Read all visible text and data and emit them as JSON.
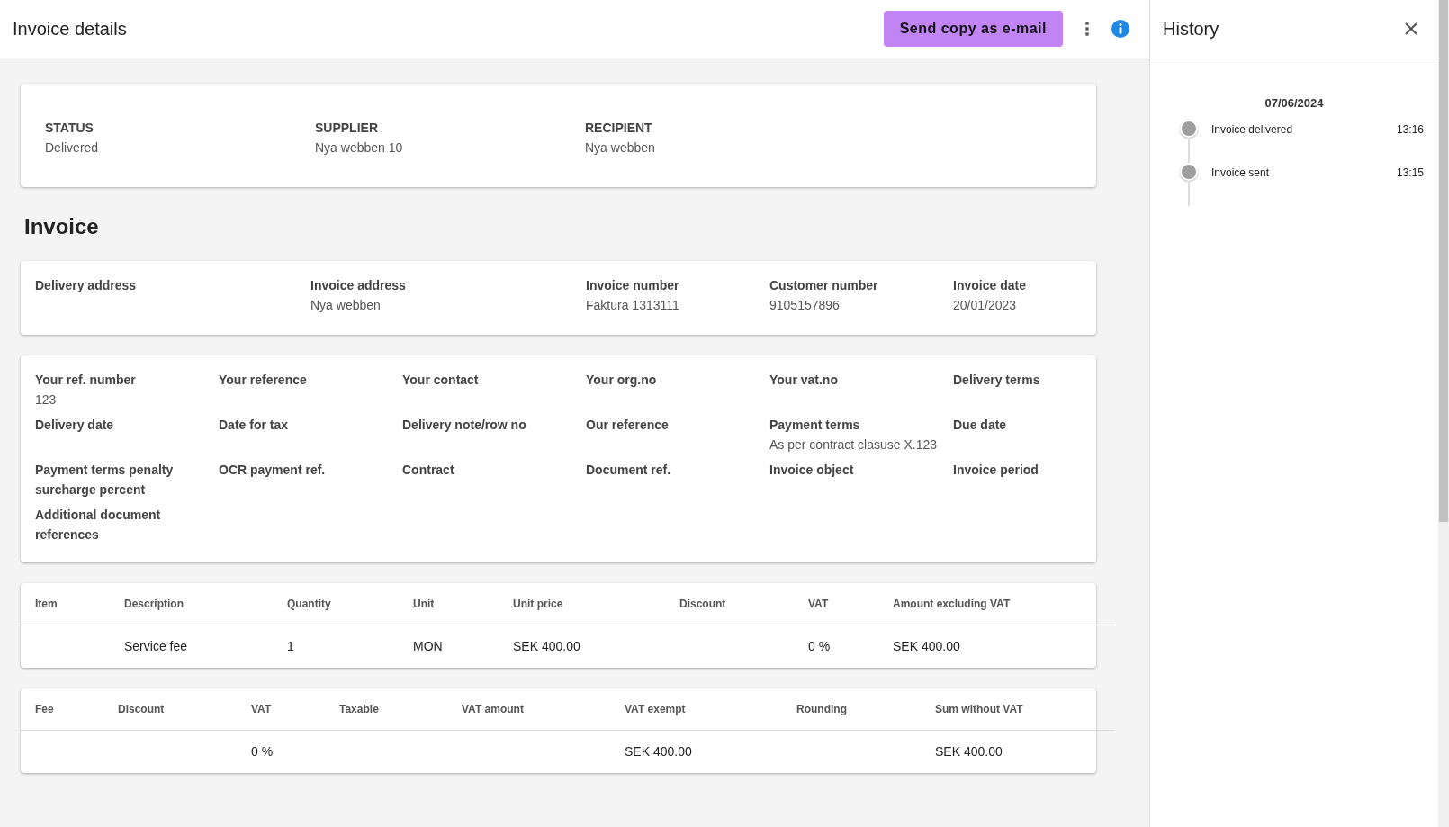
{
  "header": {
    "title": "Invoice details",
    "send_button": "Send copy as e-mail"
  },
  "status_card": [
    {
      "label": "STATUS",
      "value": "Delivered"
    },
    {
      "label": "SUPPLIER",
      "value": "Nya webben 10"
    },
    {
      "label": "RECIPIENT",
      "value": "Nya webben"
    }
  ],
  "invoice_heading": "Invoice",
  "address_card": [
    {
      "label": "Delivery address"
    },
    {
      "label": "Invoice address",
      "value": "Nya webben"
    },
    {
      "label": "Invoice number",
      "value": "Faktura 1313111"
    },
    {
      "label": "Customer number",
      "value": "9105157896"
    },
    {
      "label": "Invoice date",
      "value": "20/01/2023"
    }
  ],
  "details_card": [
    {
      "label": "Your ref. number",
      "value": "123"
    },
    {
      "label": "Your reference"
    },
    {
      "label": "Your contact"
    },
    {
      "label": "Your org.no"
    },
    {
      "label": "Your vat.no"
    },
    {
      "label": "Delivery terms"
    },
    {
      "label": "Delivery date"
    },
    {
      "label": "Date for tax"
    },
    {
      "label": "Delivery note/row no"
    },
    {
      "label": "Our reference"
    },
    {
      "label": "Payment terms",
      "value": "As per contract clasuse X.123"
    },
    {
      "label": "Due date"
    },
    {
      "label": "Payment terms penalty surcharge percent"
    },
    {
      "label": "OCR payment ref."
    },
    {
      "label": "Contract"
    },
    {
      "label": "Document ref."
    },
    {
      "label": "Invoice object"
    },
    {
      "label": "Invoice period"
    },
    {
      "label": "Additional document references"
    }
  ],
  "lines_table": {
    "columns": [
      "Item",
      "Description",
      "Quantity",
      "Unit",
      "Unit price",
      "Discount",
      "VAT",
      "Amount excluding VAT"
    ],
    "rows": [
      [
        "",
        "Service fee",
        "1",
        "MON",
        "SEK 400.00",
        "",
        "0 %",
        "SEK 400.00"
      ]
    ]
  },
  "totals_table": {
    "columns": [
      "Fee",
      "Discount",
      "VAT",
      "Taxable",
      "VAT amount",
      "VAT exempt",
      "Rounding",
      "Sum without VAT"
    ],
    "rows": [
      [
        "",
        "",
        "0 %",
        "",
        "",
        "SEK 400.00",
        "",
        "SEK 400.00"
      ]
    ]
  },
  "history": {
    "title": "History",
    "date": "07/06/2024",
    "events": [
      {
        "label": "Invoice delivered",
        "time": "13:16"
      },
      {
        "label": "Invoice sent",
        "time": "13:15"
      }
    ]
  }
}
